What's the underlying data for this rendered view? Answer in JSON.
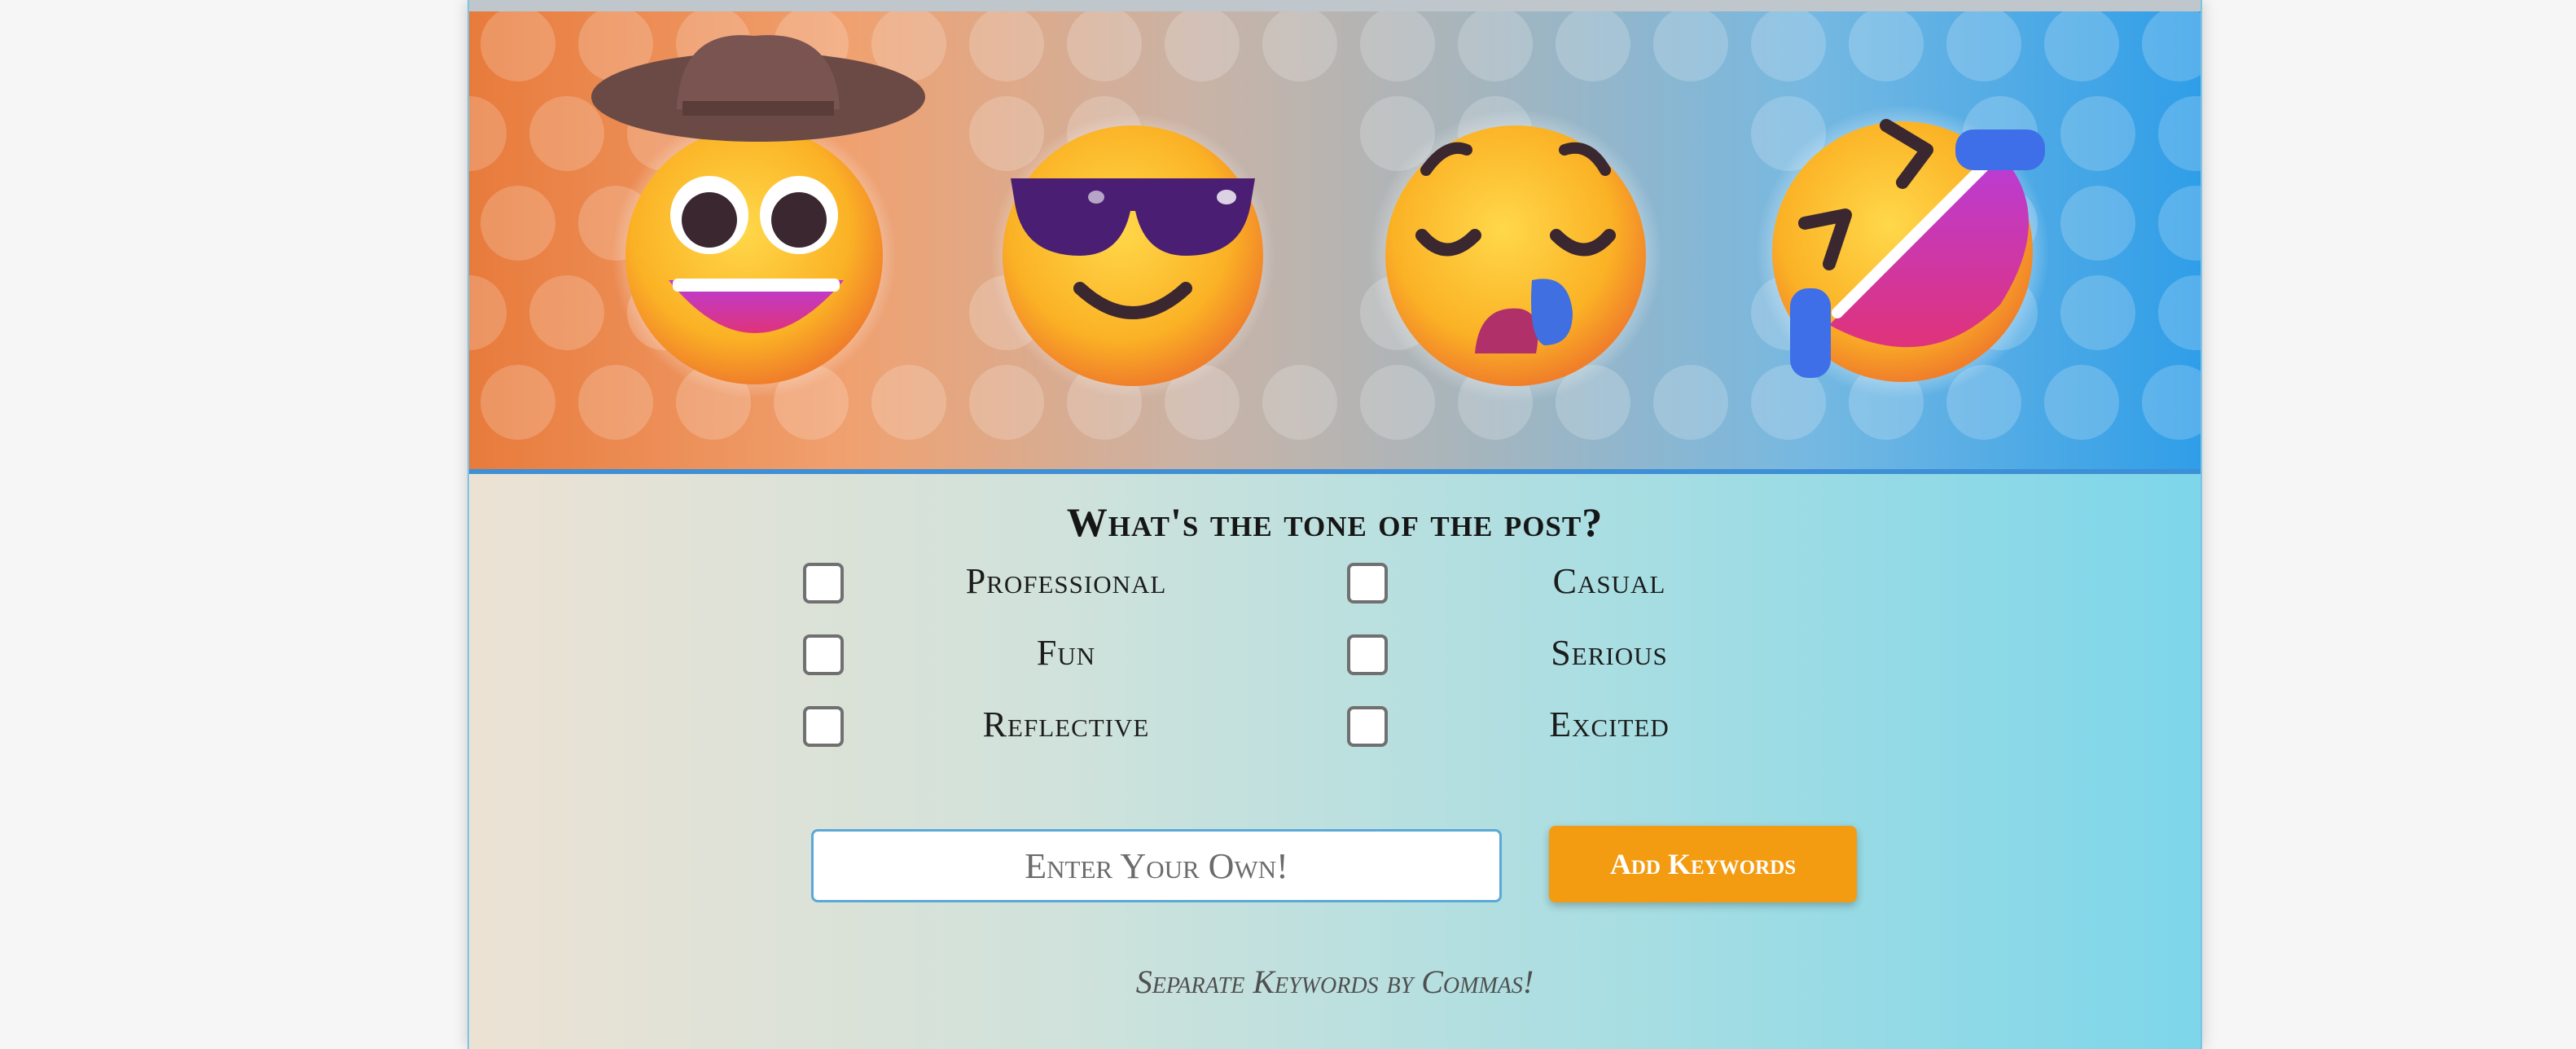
{
  "banner": {
    "emojis": [
      "cowboy-hat-face-icon",
      "smiling-face-with-sunglasses-icon",
      "sleepy-face-icon",
      "rolling-on-the-floor-laughing-icon"
    ]
  },
  "form": {
    "title": "What's the tone of the post?",
    "options": [
      {
        "label": "Professional",
        "checked": false
      },
      {
        "label": "Casual",
        "checked": false
      },
      {
        "label": "Fun",
        "checked": false
      },
      {
        "label": "Serious",
        "checked": false
      },
      {
        "label": "Reflective",
        "checked": false
      },
      {
        "label": "Excited",
        "checked": false
      }
    ],
    "keyword_input": {
      "placeholder": "Enter Your Own!",
      "value": ""
    },
    "add_button_label": "Add Keywords",
    "hint": "Separate Keywords by Commas!"
  },
  "colors": {
    "accent": "#f39c12",
    "border_blue": "#5aa9d8"
  }
}
